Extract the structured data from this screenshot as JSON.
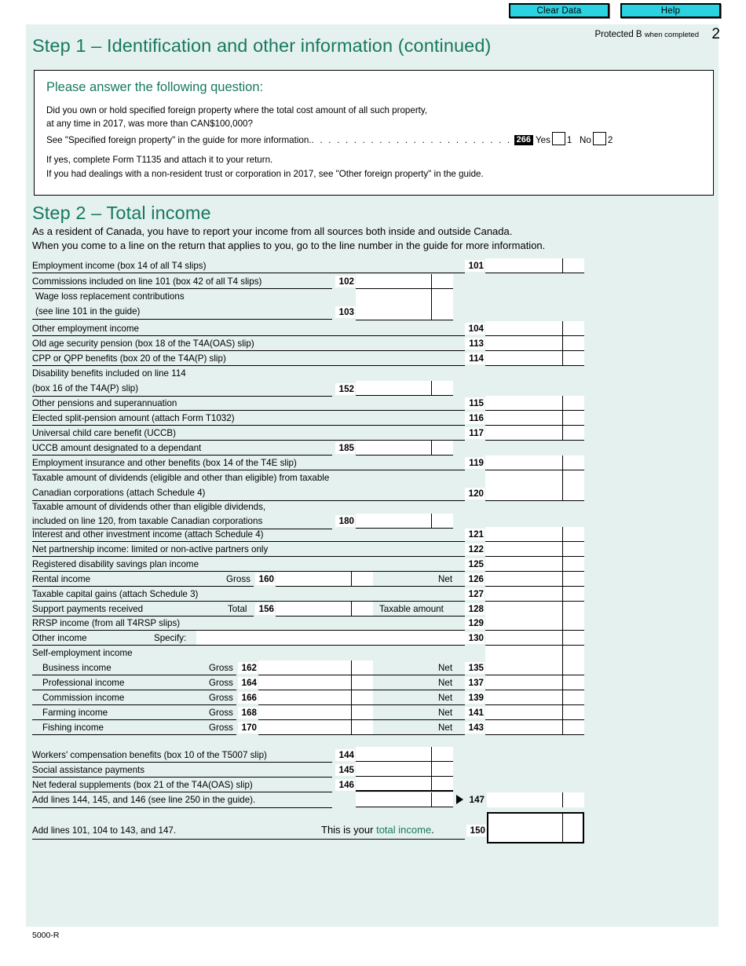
{
  "toolbar": {
    "clear_label": "Clear Data",
    "help_label": "Help"
  },
  "header": {
    "step1_title": "Step 1 – Identification and other information (continued)",
    "protected_main": "Protected B",
    "protected_small": "when completed",
    "page_number": "2"
  },
  "question_box": {
    "title": "Please answer the following question:",
    "line1": "Did you own or hold specified foreign property where the total cost amount of all such property,",
    "line2": "at any time in 2017, was more than CAN$100,000?",
    "line3_pre": "See \"Specified foreign property\" in the guide for more information.",
    "dots": ". . . . . . . . . . . . . . . . . . . . . . . .",
    "code": "266",
    "yes_label": "Yes",
    "yes_value": "1",
    "no_label": "No",
    "no_value": "2",
    "note1": "If yes, complete Form T1135 and attach it to your return.",
    "note2": "If you had dealings with a non-resident trust or corporation in 2017, see \"Other foreign property\" in the guide."
  },
  "step2": {
    "title": "Step 2 – Total income",
    "intro1": "As a resident of Canada, you have to report your income from all sources both inside and outside Canada.",
    "intro2": "When you come to a line on the return that applies to you, go to the line number in the guide for more information."
  },
  "lines": {
    "l101": {
      "label": "Employment income (box 14 of all T4 slips)",
      "no": "101",
      "value": ""
    },
    "l102": {
      "label": "Commissions included on line 101 (box 42 of all T4 slips)",
      "no": "102",
      "value": ""
    },
    "l103": {
      "label_a": "Wage loss replacement contributions",
      "label_b": "(see line 101 in the guide)",
      "no": "103",
      "value": ""
    },
    "l104": {
      "label": "Other employment income",
      "no": "104",
      "op": "+",
      "value": ""
    },
    "l113": {
      "label": "Old age security pension (box 18 of the T4A(OAS) slip)",
      "no": "113",
      "op": "+",
      "value": ""
    },
    "l114": {
      "label": "CPP or QPP benefits (box 20 of the T4A(P) slip)",
      "no": "114",
      "op": "+",
      "value": ""
    },
    "l152": {
      "label_a": "Disability benefits included on line 114",
      "label_b": "(box 16 of the T4A(P) slip)",
      "no": "152",
      "value": ""
    },
    "l115": {
      "label": "Other pensions and superannuation",
      "no": "115",
      "op": "+",
      "value": ""
    },
    "l116": {
      "label": "Elected split-pension amount (attach Form T1032)",
      "no": "116",
      "op": "+",
      "value": ""
    },
    "l117": {
      "label": "Universal child care benefit (UCCB)",
      "no": "117",
      "op": "+",
      "value": ""
    },
    "l185": {
      "label": "UCCB amount designated to a dependant",
      "no": "185",
      "value": ""
    },
    "l119": {
      "label": "Employment insurance and other benefits (box 14 of the T4E slip)",
      "no": "119",
      "op": "+",
      "value": ""
    },
    "l120": {
      "label_a": "Taxable amount of dividends (eligible and other than eligible) from taxable",
      "label_b": "Canadian corporations (attach Schedule 4)",
      "no": "120",
      "op": "+",
      "value": ""
    },
    "l180": {
      "label_a": "Taxable amount of dividends other than eligible dividends,",
      "label_b": "included on line 120, from taxable Canadian corporations",
      "no": "180",
      "value": ""
    },
    "l121": {
      "label": "Interest and other investment income (attach Schedule 4)",
      "no": "121",
      "op": "+",
      "value": ""
    },
    "l122": {
      "label": "Net partnership income: limited or non-active partners only",
      "no": "122",
      "op": "+",
      "value": ""
    },
    "l125": {
      "label": "Registered disability savings plan income",
      "no": "125",
      "op": "+",
      "value": ""
    },
    "l126": {
      "label": "Rental income",
      "gross_label": "Gross",
      "gross_no": "160",
      "gross_value": "",
      "net_label": "Net",
      "no": "126",
      "op": "+",
      "value": ""
    },
    "l127": {
      "label": "Taxable capital gains (attach Schedule 3)",
      "no": "127",
      "op": "+",
      "value": ""
    },
    "l128": {
      "label": "Support payments received",
      "gross_label": "Total",
      "gross_no": "156",
      "gross_value": "",
      "net_label": "Taxable amount",
      "no": "128",
      "op": "+",
      "value": ""
    },
    "l129": {
      "label": "RRSP income (from all T4RSP slips)",
      "no": "129",
      "op": "+",
      "value": ""
    },
    "l130": {
      "label": "Other income",
      "specify_label": "Specify:",
      "specify_value": "",
      "no": "130",
      "op": "+",
      "value": ""
    },
    "self_heading": "Self-employment income",
    "l135": {
      "label": "Business income",
      "gross_label": "Gross",
      "gross_no": "162",
      "gross_value": "",
      "net_label": "Net",
      "no": "135",
      "op": "+",
      "value": ""
    },
    "l137": {
      "label": "Professional income",
      "gross_label": "Gross",
      "gross_no": "164",
      "gross_value": "",
      "net_label": "Net",
      "no": "137",
      "op": "+",
      "value": ""
    },
    "l139": {
      "label": "Commission income",
      "gross_label": "Gross",
      "gross_no": "166",
      "gross_value": "",
      "net_label": "Net",
      "no": "139",
      "op": "+",
      "value": ""
    },
    "l141": {
      "label": "Farming income",
      "gross_label": "Gross",
      "gross_no": "168",
      "gross_value": "",
      "net_label": "Net",
      "no": "141",
      "op": "+",
      "value": ""
    },
    "l143": {
      "label": "Fishing income",
      "gross_label": "Gross",
      "gross_no": "170",
      "gross_value": "",
      "net_label": "Net",
      "no": "143",
      "op": "+",
      "value": ""
    },
    "l144": {
      "label": "Workers' compensation benefits (box 10 of the T5007 slip)",
      "no": "144",
      "value": ""
    },
    "l145": {
      "label": "Social assistance payments",
      "no": "145",
      "op": "+",
      "value": ""
    },
    "l146": {
      "label": "Net federal supplements (box 21 of the T4A(OAS) slip)",
      "no": "146",
      "op": "+",
      "value": ""
    },
    "l147": {
      "label": "Add lines 144, 145, and 146 (see line 250 in the guide).",
      "sub_op": "=",
      "sub_value": "",
      "no": "147",
      "op": "+",
      "value": ""
    },
    "l150": {
      "label": "Add lines 101, 104 to 143, and 147.",
      "caption_pre": "This is your ",
      "caption_link": "total income",
      "caption_post": ".",
      "no": "150",
      "op": "=",
      "value": ""
    }
  },
  "footer": {
    "form_code": "5000-R"
  }
}
